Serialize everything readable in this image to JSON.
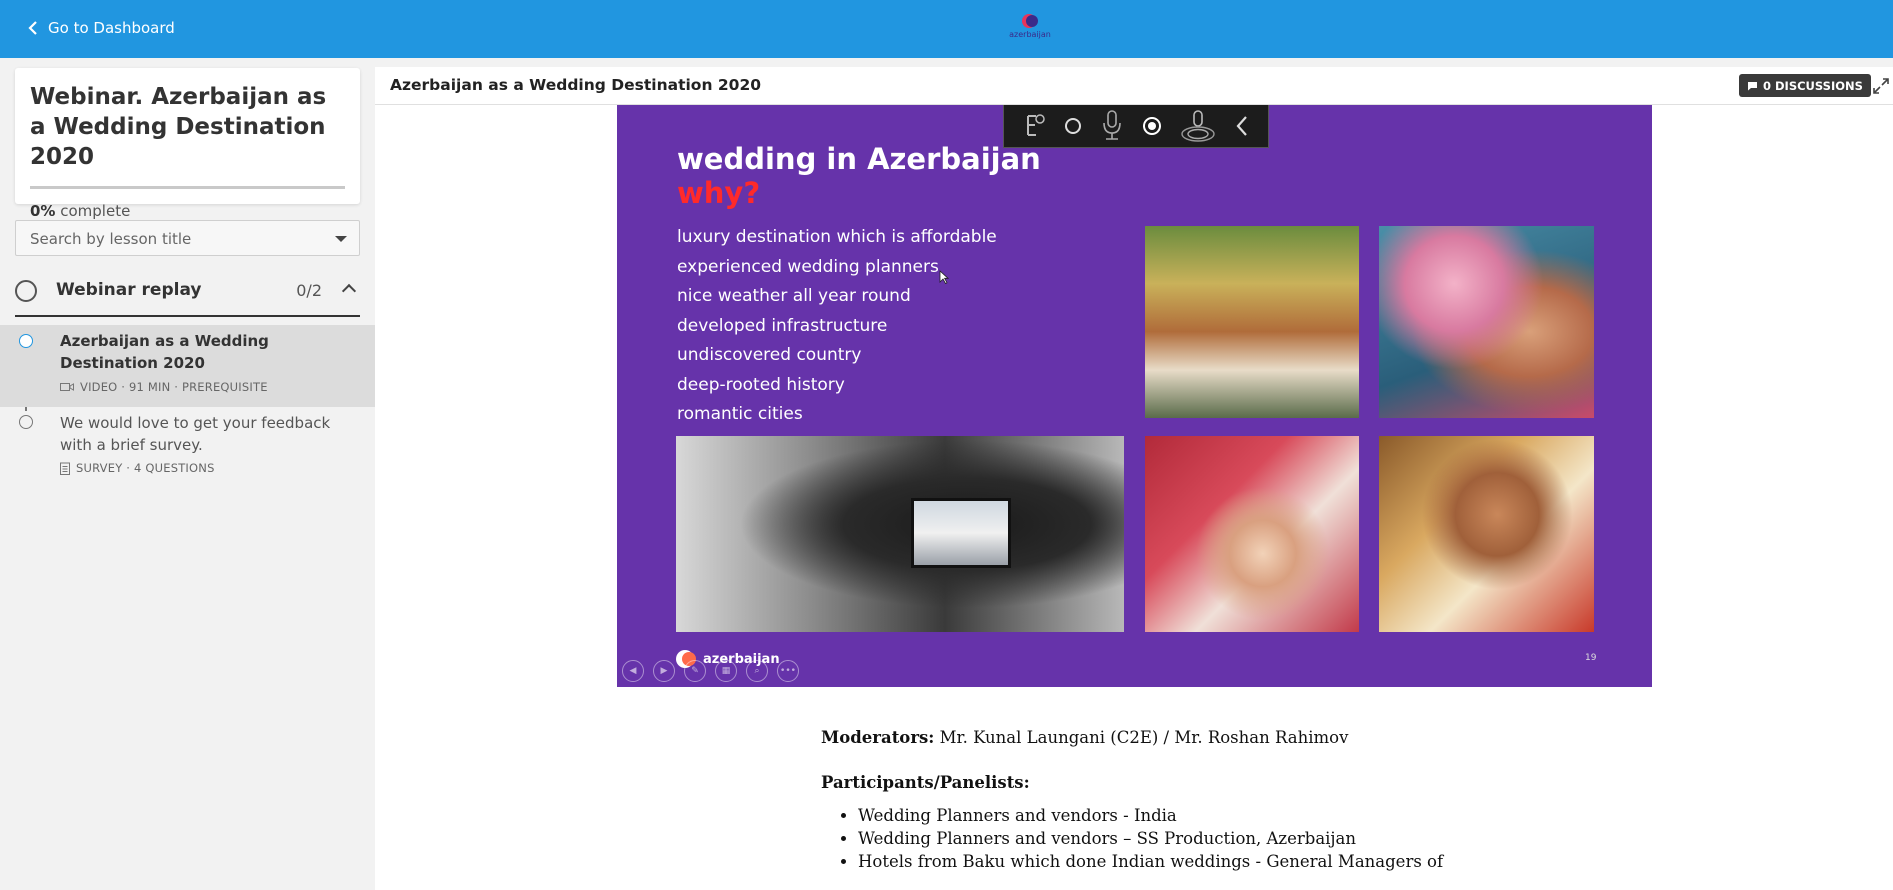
{
  "topbar": {
    "back_label": "Go to Dashboard",
    "logo_text": "azerbaijan"
  },
  "sidebar": {
    "course_title": "Webinar. Azerbaijan as a Wedding Destination 2020",
    "progress_value": "0%",
    "progress_label": "complete",
    "progress_fraction": 0,
    "search_placeholder": "Search by lesson title",
    "section": {
      "title": "Webinar replay",
      "count": "0/2"
    },
    "lessons": [
      {
        "title": "Azerbaijan as a Wedding Destination 2020",
        "meta": "VIDEO · 91 MIN · PREREQUISITE",
        "icon": "video-icon",
        "active": true
      },
      {
        "title": "We would love to get your feedback with a brief survey.",
        "meta": "SURVEY · 4 QUESTIONS",
        "icon": "survey-icon",
        "active": false
      }
    ]
  },
  "main": {
    "lesson_title": "Azerbaijan as a Wedding Destination 2020",
    "discussions_label": "0 DISCUSSIONS",
    "slide": {
      "title": "wedding in Azerbaijan",
      "subtitle": "why?",
      "bullets": [
        "luxury destination which is affordable",
        "experienced wedding planners",
        "nice weather all year round",
        "developed infrastructure",
        "undiscovered country",
        "deep-rooted history",
        "romantic cities"
      ],
      "logo_text": "azerbaijan",
      "page_number": "19"
    },
    "article": {
      "moderators_label": "Moderators:",
      "moderators_value": " Mr. Kunal Laungani (C2E) / Mr. Roshan Rahimov",
      "participants_label": "Participants/Panelists:",
      "participants": [
        "Wedding Planners and vendors - India",
        "Wedding Planners and vendors – SS Production, Azerbaijan",
        "Hotels from Baku which done Indian weddings - General Managers of"
      ]
    }
  },
  "colors": {
    "topbar": "#2196e0",
    "slide_background": "#6633aa",
    "slide_accent": "#ff2a2a"
  }
}
